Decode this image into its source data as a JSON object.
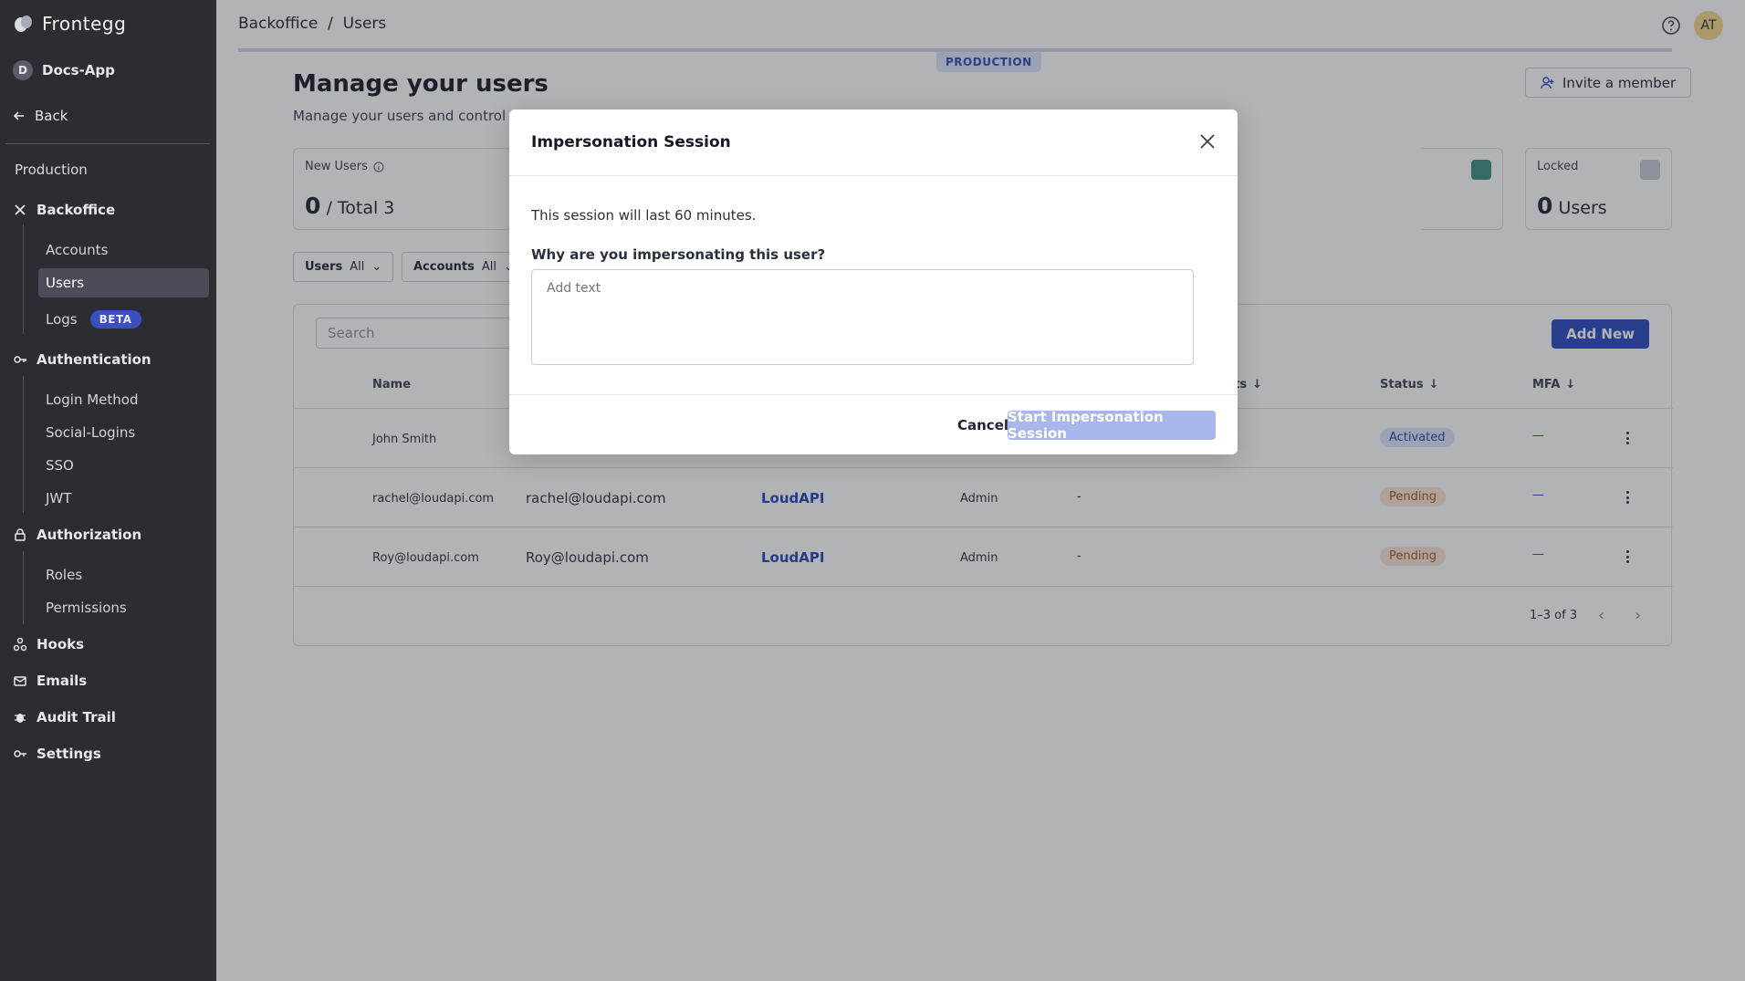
{
  "sidebar": {
    "brand": "Frontegg",
    "app_initial": "D",
    "app_name": "Docs-App",
    "back": "Back",
    "environment": "Production",
    "backoffice": "Backoffice",
    "backoffice_items": [
      "Accounts",
      "Users",
      "Logs"
    ],
    "beta_badge": "BETA",
    "authentication": "Authentication",
    "authentication_items": [
      "Login Method",
      "Social-Logins",
      "SSO",
      "JWT"
    ],
    "authorization": "Authorization",
    "authorization_items": [
      "Roles",
      "Permissions"
    ],
    "hooks": "Hooks",
    "emails": "Emails",
    "audit_trail": "Audit Trail",
    "settings": "Settings"
  },
  "header": {
    "breadcrumb": "Backoffice  /  Users",
    "avatar_initials": "AT",
    "environment_tag": "PRODUCTION"
  },
  "page": {
    "title": "Manage your users",
    "subtitle": "Manage your users and control their",
    "invite_label": "Invite a member"
  },
  "cards": {
    "new_users_label": "New Users",
    "new_users_value": "0",
    "new_users_total": "/ Total 3",
    "locked_label": "Locked",
    "locked_value": "0",
    "locked_unit": "Users"
  },
  "filters": {
    "users_label": "Users",
    "users_value": "All",
    "accounts_label": "Accounts",
    "accounts_value": "All"
  },
  "table": {
    "search_placeholder": "Search",
    "add_new": "Add New",
    "columns": {
      "name": "Name",
      "visits": "sits",
      "status": "Status",
      "mfa": "MFA"
    },
    "rows": [
      {
        "name": "John Smith",
        "email": "",
        "account": "",
        "role": "",
        "last": "",
        "status": "Activated",
        "mfa": "—"
      },
      {
        "name": "rachel@loudapi.com",
        "email": "rachel@loudapi.com",
        "account": "LoudAPI",
        "role": "Admin",
        "last": "-",
        "status": "Pending",
        "mfa": "—"
      },
      {
        "name": "Roy@loudapi.com",
        "email": "Roy@loudapi.com",
        "account": "LoudAPI",
        "role": "Admin",
        "last": "-",
        "status": "Pending",
        "mfa": "—"
      }
    ],
    "pagination": "1–3 of 3"
  },
  "modal": {
    "title": "Impersonation Session",
    "note": "This session will last 60 minutes.",
    "question": "Why are you impersonating this user?",
    "placeholder": "Add text",
    "cancel": "Cancel",
    "start": "Start Impersonation Session"
  },
  "colors": {
    "sidebar_bg": "#2b2d33",
    "primary": "#2d49c0",
    "primary_disabled": "#a9b6ec"
  }
}
